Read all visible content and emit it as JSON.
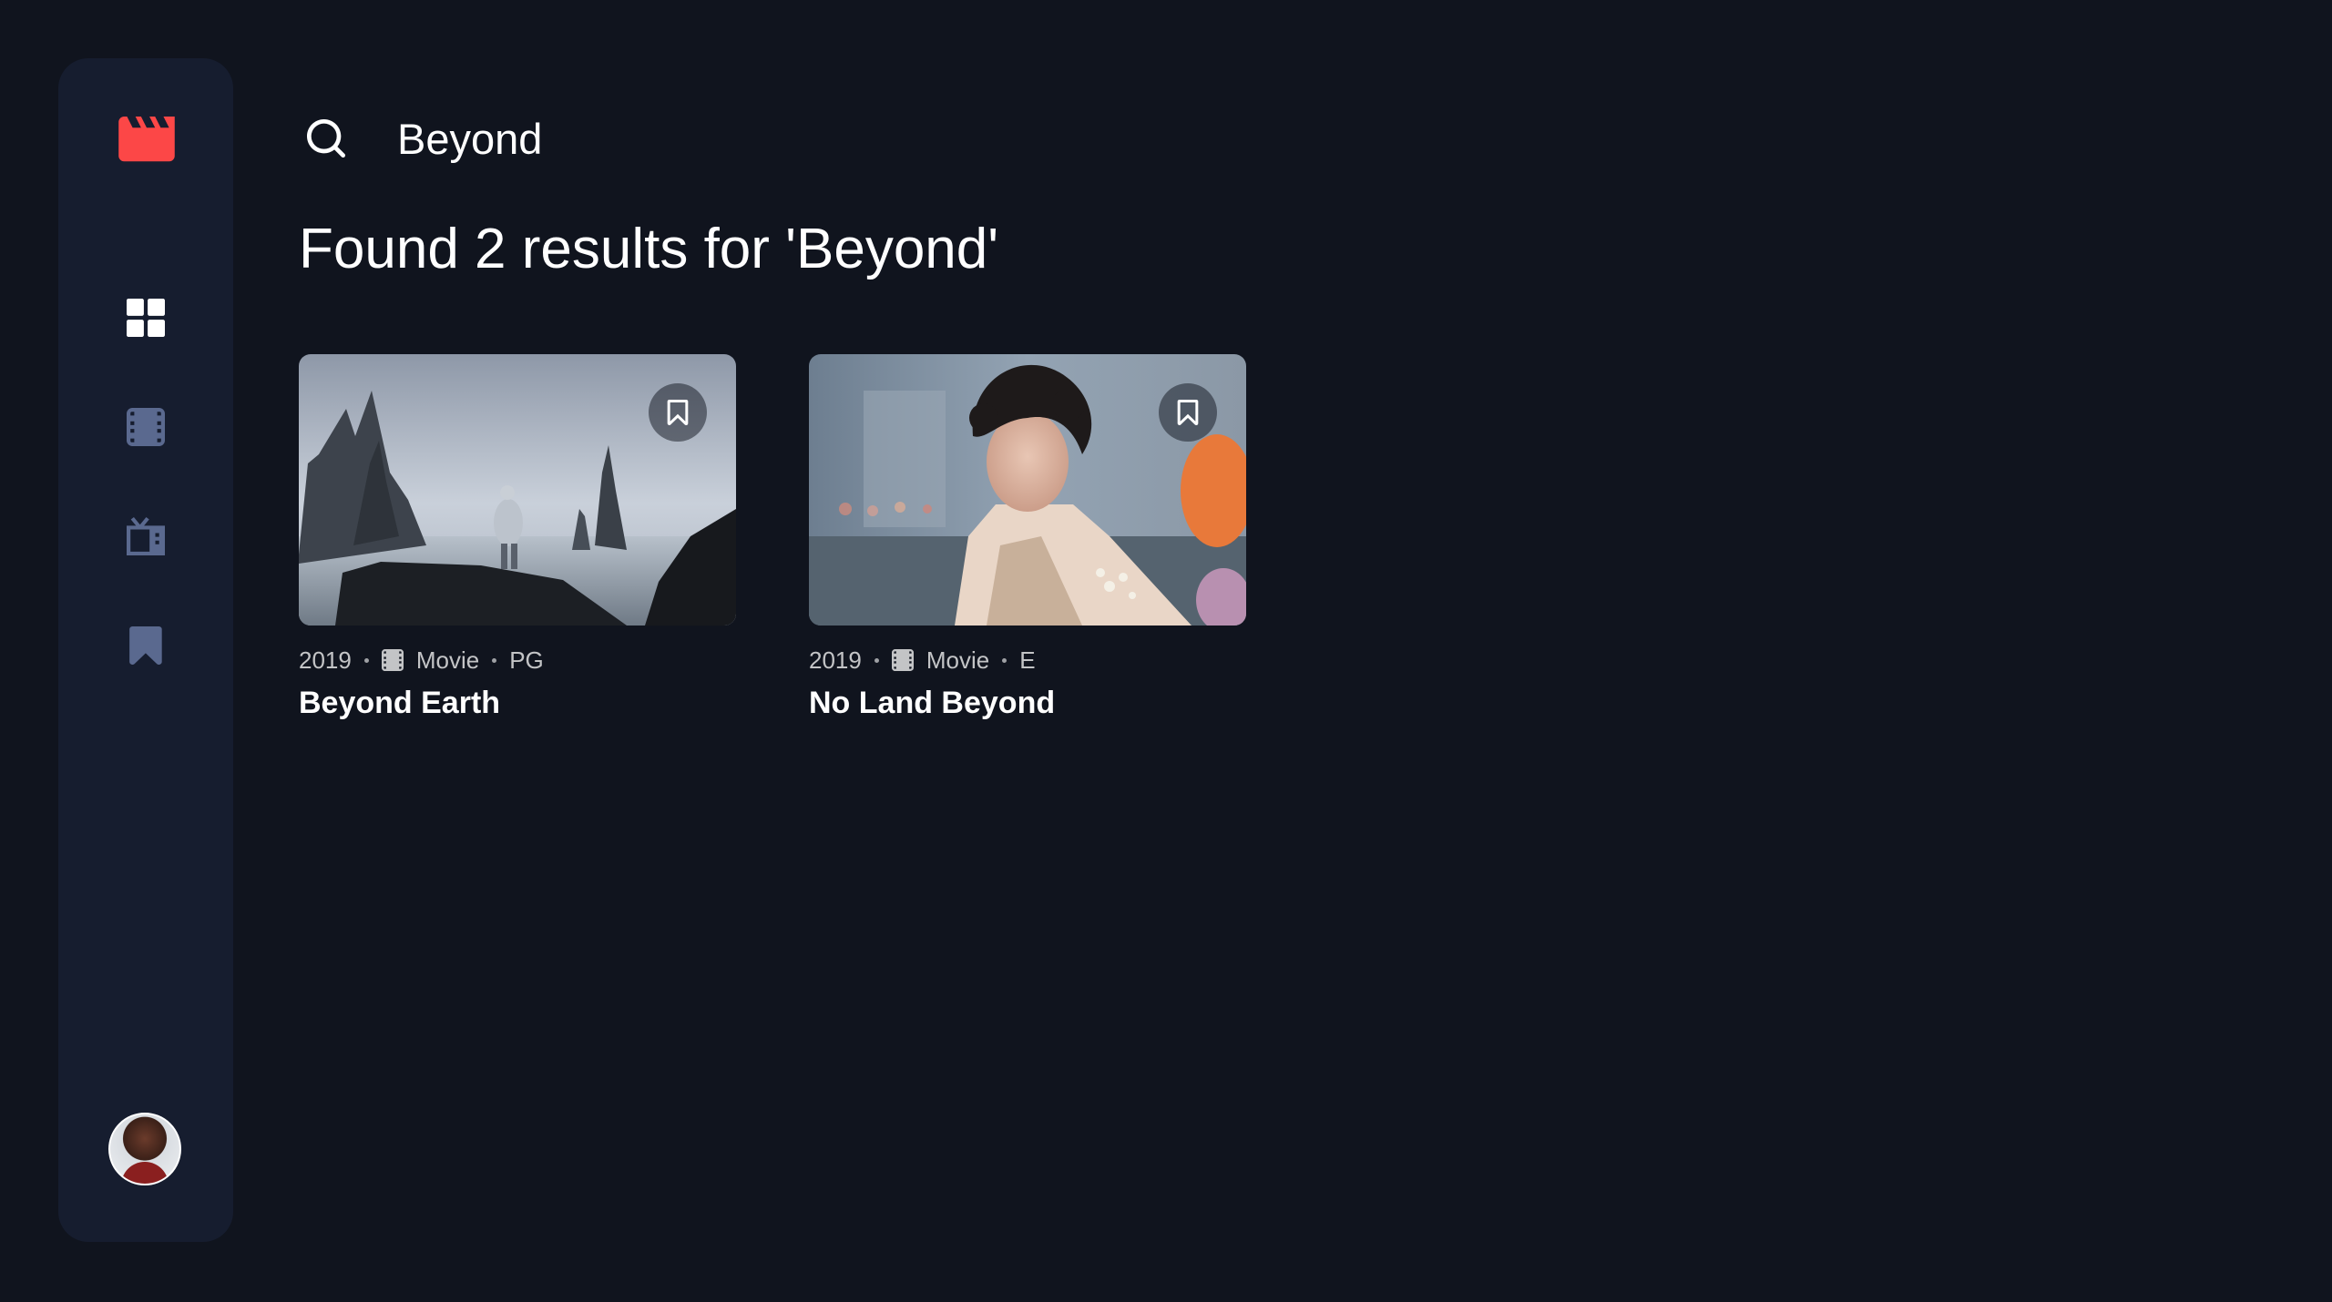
{
  "app": {
    "logo_icon": "clapperboard-icon",
    "accent_color": "#FC4747",
    "background_color": "#10141E",
    "surface_color": "#161D2F"
  },
  "nav": {
    "items": [
      {
        "icon": "grid-icon",
        "label": "Home",
        "active": true
      },
      {
        "icon": "film-icon",
        "label": "Movies",
        "active": false
      },
      {
        "icon": "tv-icon",
        "label": "TV Series",
        "active": false
      },
      {
        "icon": "bookmark-icon",
        "label": "Bookmarked",
        "active": false
      }
    ],
    "inactive_color": "#5A698F"
  },
  "search": {
    "icon": "search-icon",
    "value": "Beyond"
  },
  "results": {
    "heading": "Found 2 results for 'Beyond'",
    "items": [
      {
        "year": "2019",
        "category": "Movie",
        "category_icon": "film-icon",
        "rating": "PG",
        "title": "Beyond Earth",
        "bookmarked": false
      },
      {
        "year": "2019",
        "category": "Movie",
        "category_icon": "film-icon",
        "rating": "E",
        "title": "No Land Beyond",
        "bookmarked": false
      }
    ]
  },
  "profile": {
    "icon": "avatar"
  }
}
